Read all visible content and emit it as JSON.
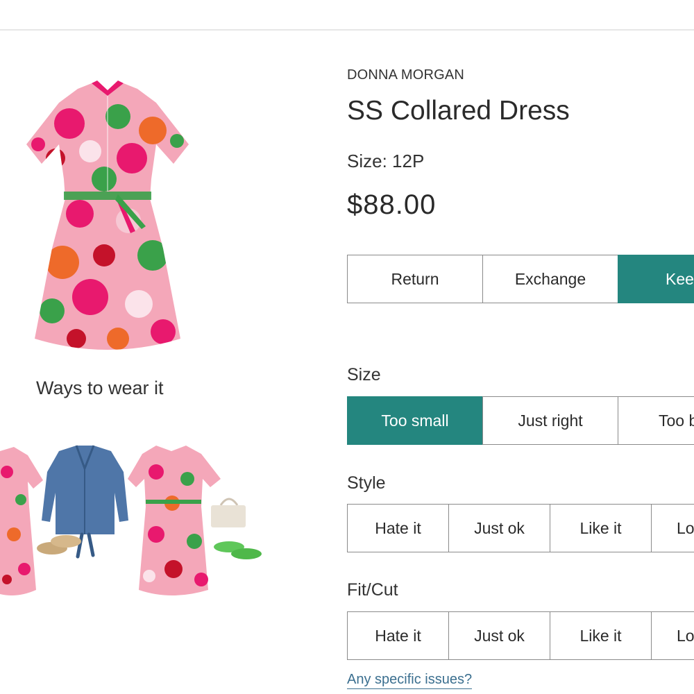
{
  "product": {
    "brand": "DONNA MORGAN",
    "title": "SS Collared Dress",
    "size_label": "Size: 12P",
    "price": "$88.00"
  },
  "decision": {
    "options": [
      {
        "label": "Return",
        "selected": false
      },
      {
        "label": "Exchange",
        "selected": false
      },
      {
        "label": "Keep",
        "selected": true
      }
    ]
  },
  "gallery": {
    "ways_heading": "Ways to wear it"
  },
  "feedback": {
    "size": {
      "label": "Size",
      "options": [
        {
          "label": "Too small",
          "selected": true
        },
        {
          "label": "Just right",
          "selected": false
        },
        {
          "label": "Too big",
          "selected": false
        }
      ]
    },
    "style": {
      "label": "Style",
      "options": [
        {
          "label": "Hate it"
        },
        {
          "label": "Just ok"
        },
        {
          "label": "Like it"
        },
        {
          "label": "Love it"
        }
      ]
    },
    "fit": {
      "label": "Fit/Cut",
      "options": [
        {
          "label": "Hate it"
        },
        {
          "label": "Just ok"
        },
        {
          "label": "Like it"
        },
        {
          "label": "Love it"
        }
      ]
    },
    "issues_link": "Any specific issues?"
  },
  "colors": {
    "accent": "#24867f",
    "link": "#3b6f8f"
  }
}
